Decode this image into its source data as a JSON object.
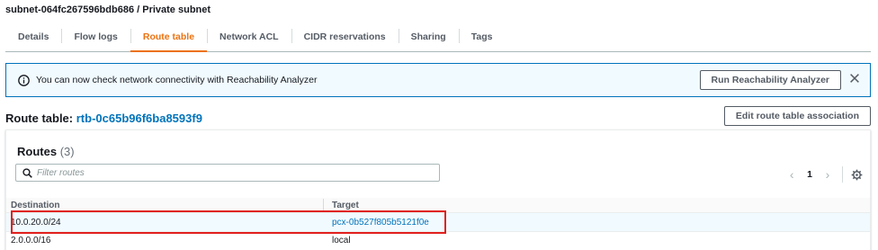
{
  "breadcrumb": "subnet-064fc267596bdb686 / Private subnet",
  "tabs": [
    {
      "label": "Details",
      "active": false
    },
    {
      "label": "Flow logs",
      "active": false
    },
    {
      "label": "Route table",
      "active": true
    },
    {
      "label": "Network ACL",
      "active": false
    },
    {
      "label": "CIDR reservations",
      "active": false
    },
    {
      "label": "Sharing",
      "active": false
    },
    {
      "label": "Tags",
      "active": false
    }
  ],
  "alert": {
    "icon": "info-icon",
    "message": "You can now check network connectivity with Reachability Analyzer",
    "button_label": "Run Reachability Analyzer",
    "close_icon": "close-icon"
  },
  "route_table": {
    "heading_prefix": "Route table: ",
    "id": "rtb-0c65b96f6ba8593f9",
    "edit_button_label": "Edit route table association"
  },
  "routes_panel": {
    "title": "Routes",
    "count": "(3)",
    "filter_placeholder": "Filter routes",
    "pagination": {
      "current_page": "1",
      "prev": "‹",
      "next": "›"
    },
    "columns": [
      "Destination",
      "Target"
    ],
    "rows": [
      {
        "destination": "10.0.20.0/24",
        "target": "pcx-0b527f805b5121f0e",
        "target_is_link": true
      },
      {
        "destination": "2.0.0.0/16",
        "target": "local",
        "target_is_link": false
      }
    ]
  },
  "colors": {
    "accent_tab": "#ec7211",
    "link": "#0073bb",
    "alert_border": "#0073bb",
    "alert_bg": "#f1faff",
    "highlight_box": "#e0201d"
  }
}
